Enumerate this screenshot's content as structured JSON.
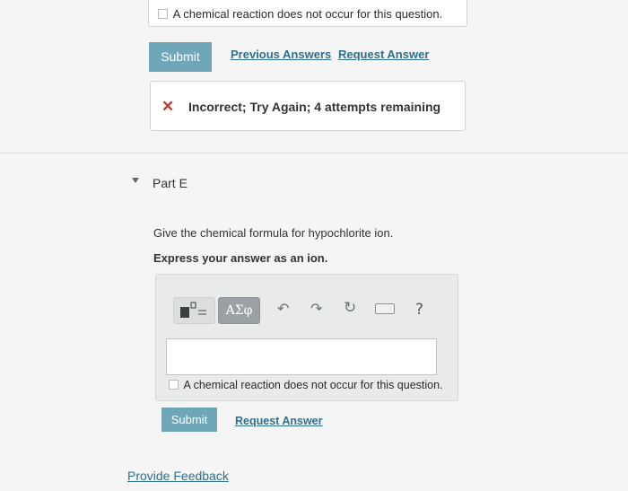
{
  "prev_part": {
    "no_reaction_label": "A chemical reaction does not occur for this question.",
    "submit_label": "Submit",
    "previous_answers_label": "Previous Answers",
    "request_answer_label": "Request Answer",
    "feedback": {
      "icon": "x-mark-icon",
      "text": "Incorrect; Try Again; 4 attempts remaining"
    }
  },
  "part_e": {
    "title": "Part E",
    "question": "Give the chemical formula for hypochlorite ion.",
    "instruction": "Express your answer as an ion.",
    "toolbar": {
      "greek_label": "ΑΣφ",
      "help_label": "?"
    },
    "answer_value": "",
    "no_reaction_label": "A chemical reaction does not occur for this question.",
    "submit_label": "Submit",
    "request_answer_label": "Request Answer"
  },
  "footer": {
    "provide_feedback_label": "Provide Feedback"
  },
  "colors": {
    "submit_button": "#6fa6b8",
    "link": "#2f6f8c",
    "error": "#c0392b",
    "background": "#f4f5f4"
  }
}
